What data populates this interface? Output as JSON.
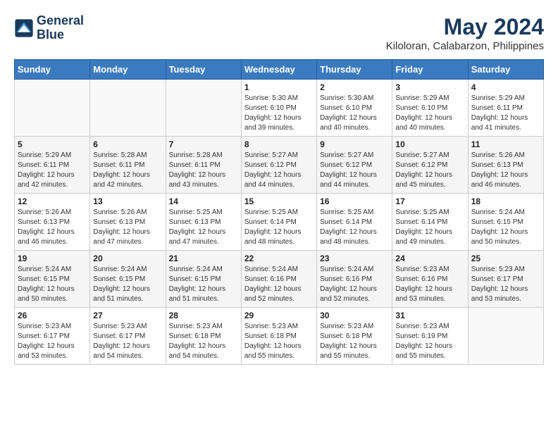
{
  "header": {
    "logo_line1": "General",
    "logo_line2": "Blue",
    "title": "May 2024",
    "subtitle": "Kiloloran, Calabarzon, Philippines"
  },
  "calendar": {
    "weekdays": [
      "Sunday",
      "Monday",
      "Tuesday",
      "Wednesday",
      "Thursday",
      "Friday",
      "Saturday"
    ],
    "weeks": [
      [
        {
          "day": "",
          "info": ""
        },
        {
          "day": "",
          "info": ""
        },
        {
          "day": "",
          "info": ""
        },
        {
          "day": "1",
          "info": "Sunrise: 5:30 AM\nSunset: 6:10 PM\nDaylight: 12 hours\nand 39 minutes."
        },
        {
          "day": "2",
          "info": "Sunrise: 5:30 AM\nSunset: 6:10 PM\nDaylight: 12 hours\nand 40 minutes."
        },
        {
          "day": "3",
          "info": "Sunrise: 5:29 AM\nSunset: 6:10 PM\nDaylight: 12 hours\nand 40 minutes."
        },
        {
          "day": "4",
          "info": "Sunrise: 5:29 AM\nSunset: 6:11 PM\nDaylight: 12 hours\nand 41 minutes."
        }
      ],
      [
        {
          "day": "5",
          "info": "Sunrise: 5:29 AM\nSunset: 6:11 PM\nDaylight: 12 hours\nand 42 minutes."
        },
        {
          "day": "6",
          "info": "Sunrise: 5:28 AM\nSunset: 6:11 PM\nDaylight: 12 hours\nand 42 minutes."
        },
        {
          "day": "7",
          "info": "Sunrise: 5:28 AM\nSunset: 6:11 PM\nDaylight: 12 hours\nand 43 minutes."
        },
        {
          "day": "8",
          "info": "Sunrise: 5:27 AM\nSunset: 6:12 PM\nDaylight: 12 hours\nand 44 minutes."
        },
        {
          "day": "9",
          "info": "Sunrise: 5:27 AM\nSunset: 6:12 PM\nDaylight: 12 hours\nand 44 minutes."
        },
        {
          "day": "10",
          "info": "Sunrise: 5:27 AM\nSunset: 6:12 PM\nDaylight: 12 hours\nand 45 minutes."
        },
        {
          "day": "11",
          "info": "Sunrise: 5:26 AM\nSunset: 6:13 PM\nDaylight: 12 hours\nand 46 minutes."
        }
      ],
      [
        {
          "day": "12",
          "info": "Sunrise: 5:26 AM\nSunset: 6:13 PM\nDaylight: 12 hours\nand 46 minutes."
        },
        {
          "day": "13",
          "info": "Sunrise: 5:26 AM\nSunset: 6:13 PM\nDaylight: 12 hours\nand 47 minutes."
        },
        {
          "day": "14",
          "info": "Sunrise: 5:25 AM\nSunset: 6:13 PM\nDaylight: 12 hours\nand 47 minutes."
        },
        {
          "day": "15",
          "info": "Sunrise: 5:25 AM\nSunset: 6:14 PM\nDaylight: 12 hours\nand 48 minutes."
        },
        {
          "day": "16",
          "info": "Sunrise: 5:25 AM\nSunset: 6:14 PM\nDaylight: 12 hours\nand 48 minutes."
        },
        {
          "day": "17",
          "info": "Sunrise: 5:25 AM\nSunset: 6:14 PM\nDaylight: 12 hours\nand 49 minutes."
        },
        {
          "day": "18",
          "info": "Sunrise: 5:24 AM\nSunset: 6:15 PM\nDaylight: 12 hours\nand 50 minutes."
        }
      ],
      [
        {
          "day": "19",
          "info": "Sunrise: 5:24 AM\nSunset: 6:15 PM\nDaylight: 12 hours\nand 50 minutes."
        },
        {
          "day": "20",
          "info": "Sunrise: 5:24 AM\nSunset: 6:15 PM\nDaylight: 12 hours\nand 51 minutes."
        },
        {
          "day": "21",
          "info": "Sunrise: 5:24 AM\nSunset: 6:15 PM\nDaylight: 12 hours\nand 51 minutes."
        },
        {
          "day": "22",
          "info": "Sunrise: 5:24 AM\nSunset: 6:16 PM\nDaylight: 12 hours\nand 52 minutes."
        },
        {
          "day": "23",
          "info": "Sunrise: 5:24 AM\nSunset: 6:16 PM\nDaylight: 12 hours\nand 52 minutes."
        },
        {
          "day": "24",
          "info": "Sunrise: 5:23 AM\nSunset: 6:16 PM\nDaylight: 12 hours\nand 53 minutes."
        },
        {
          "day": "25",
          "info": "Sunrise: 5:23 AM\nSunset: 6:17 PM\nDaylight: 12 hours\nand 53 minutes."
        }
      ],
      [
        {
          "day": "26",
          "info": "Sunrise: 5:23 AM\nSunset: 6:17 PM\nDaylight: 12 hours\nand 53 minutes."
        },
        {
          "day": "27",
          "info": "Sunrise: 5:23 AM\nSunset: 6:17 PM\nDaylight: 12 hours\nand 54 minutes."
        },
        {
          "day": "28",
          "info": "Sunrise: 5:23 AM\nSunset: 6:18 PM\nDaylight: 12 hours\nand 54 minutes."
        },
        {
          "day": "29",
          "info": "Sunrise: 5:23 AM\nSunset: 6:18 PM\nDaylight: 12 hours\nand 55 minutes."
        },
        {
          "day": "30",
          "info": "Sunrise: 5:23 AM\nSunset: 6:18 PM\nDaylight: 12 hours\nand 55 minutes."
        },
        {
          "day": "31",
          "info": "Sunrise: 5:23 AM\nSunset: 6:19 PM\nDaylight: 12 hours\nand 55 minutes."
        },
        {
          "day": "",
          "info": ""
        }
      ]
    ]
  }
}
